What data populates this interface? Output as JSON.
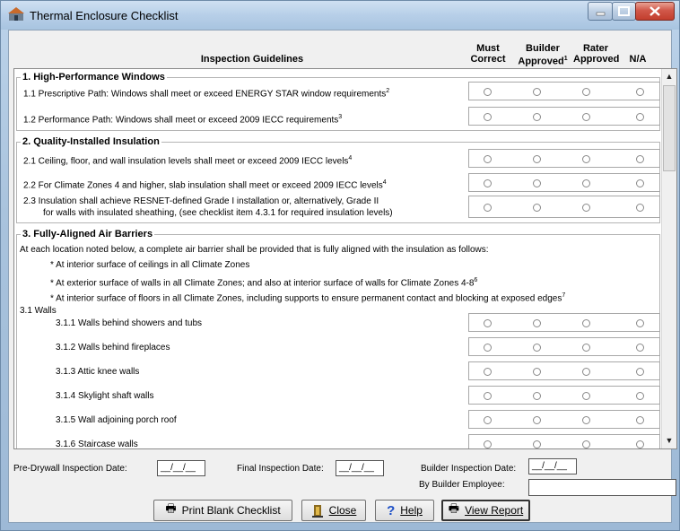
{
  "window": {
    "title": "Thermal Enclosure Checklist"
  },
  "header": {
    "guidelines": "Inspection Guidelines",
    "must_correct": "Must Correct",
    "builder_approved": "Builder Approved",
    "builder_sup": "1",
    "rater_approved": "Rater Approved",
    "na": "N/A"
  },
  "sections": [
    {
      "title": "1. High-Performance Windows",
      "items": [
        {
          "text": "1.1  Prescriptive Path: Windows shall meet or exceed ENERGY STAR window requirements",
          "sup": "2"
        },
        {
          "text": "1.2  Performance Path: Windows shall meet or exceed 2009 IECC requirements",
          "sup": "3"
        }
      ]
    },
    {
      "title": "2. Quality-Installed Insulation",
      "items": [
        {
          "text": "2.1  Ceiling, floor, and wall insulation levels shall meet or exceed 2009 IECC levels",
          "sup": "4"
        },
        {
          "text": "2.2  For Climate Zones 4 and higher, slab insulation shall meet or exceed 2009 IECC levels",
          "sup": "4"
        },
        {
          "text": "2.3  Insulation shall achieve RESNET-defined Grade I installation or, alternatively, Grade II",
          "text2": "for walls with insulated sheathing, (see checklist item 4.3.1 for required insulation levels)"
        }
      ]
    },
    {
      "title": "3. Fully-Aligned Air Barriers",
      "intro": "At each location noted below, a complete air barrier shall be provided that is fully aligned with the insulation as follows:",
      "bullets": [
        {
          "text": "* At interior surface of ceilings in all Climate Zones"
        },
        {
          "text": "* At exterior surface of walls in all Climate Zones; and also at interior surface of walls for Climate Zones 4-8",
          "sup": "6"
        },
        {
          "text": "* At interior surface of floors in all Climate Zones, including supports to ensure permanent contact and blocking at exposed edges",
          "sup": "7"
        }
      ],
      "subheading": "3.1  Walls",
      "items": [
        {
          "text": "3.1.1  Walls behind showers and tubs"
        },
        {
          "text": "3.1.2  Walls behind fireplaces"
        },
        {
          "text": "3.1.3  Attic knee walls"
        },
        {
          "text": "3.1.4  Skylight shaft walls"
        },
        {
          "text": "3.1.5  Wall adjoining porch roof"
        },
        {
          "text": "3.1.6  Staircase walls"
        }
      ]
    }
  ],
  "footer": {
    "predrywall_label": "Pre-Drywall Inspection Date:",
    "predrywall_value": "__/__/__",
    "final_label": "Final Inspection Date:",
    "final_value": "__/__/__",
    "builder_date_label": "Builder Inspection Date:",
    "builder_date_value": "__/__/__",
    "builder_employee_label": "By Builder Employee:",
    "builder_employee_value": ""
  },
  "buttons": {
    "print": "Print Blank Checklist",
    "close": "Close",
    "help": "Help",
    "view": "View Report"
  },
  "colors": {
    "title_bar": "#b7cfe8",
    "close_button": "#c23d2d",
    "help_icon": "#1c4fc7"
  }
}
